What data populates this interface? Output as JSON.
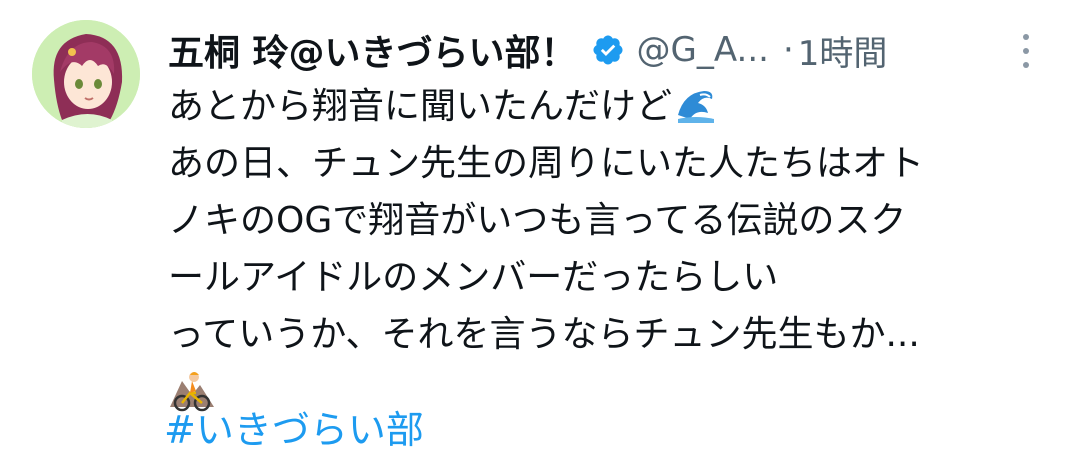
{
  "user": {
    "display_name": "五桐 玲@いきづらい部！",
    "handle": "@G_A...",
    "separator": "·",
    "time": "1時間"
  },
  "tweet": {
    "lines": [
      "あとから翔音に聞いたんだけど",
      "あの日、チュン先生の周りにいた人たちはオト",
      "ノキのOGで翔音がいつも言ってる伝説のスク",
      "ールアイドルのメンバーだったらしい",
      "っていうか、それを言うならチュン先生もか..."
    ],
    "hashtag": "#いきづらい部"
  },
  "icons": {
    "verified": "verified-badge-icon",
    "more": "more-options-icon",
    "wave": "water-wave-emoji",
    "bike": "mountain-biker-emoji"
  },
  "colors": {
    "accent": "#1d9bf0",
    "secondary_text": "#536471",
    "text": "#0f1419"
  }
}
